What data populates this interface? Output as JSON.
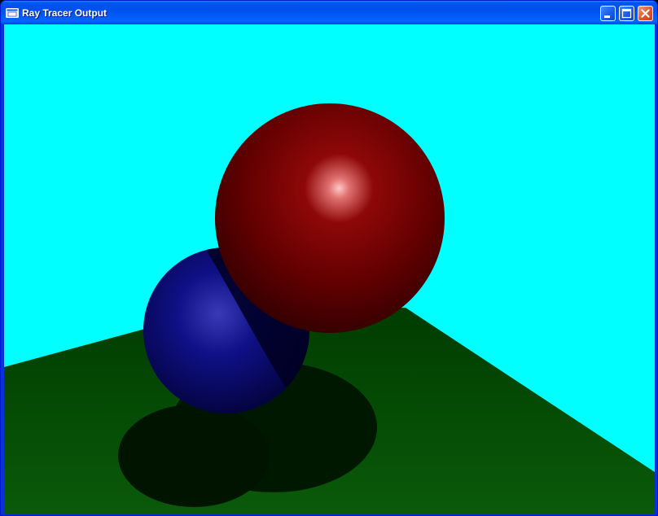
{
  "window": {
    "title": "Ray Tracer Output",
    "app_icon": "window-app-icon",
    "controls": [
      {
        "name": "minimize-button",
        "icon": "minimize-icon"
      },
      {
        "name": "maximize-button",
        "icon": "maximize-icon"
      },
      {
        "name": "close-button",
        "icon": "close-icon"
      }
    ]
  },
  "scene": {
    "background_color": "#00FFFF",
    "floor_color": "#0A4A0A",
    "shadow_color": "#001800",
    "objects": [
      {
        "name": "red-sphere",
        "color": "#8B0000"
      },
      {
        "name": "blue-sphere",
        "color": "#0A0A80"
      }
    ]
  }
}
